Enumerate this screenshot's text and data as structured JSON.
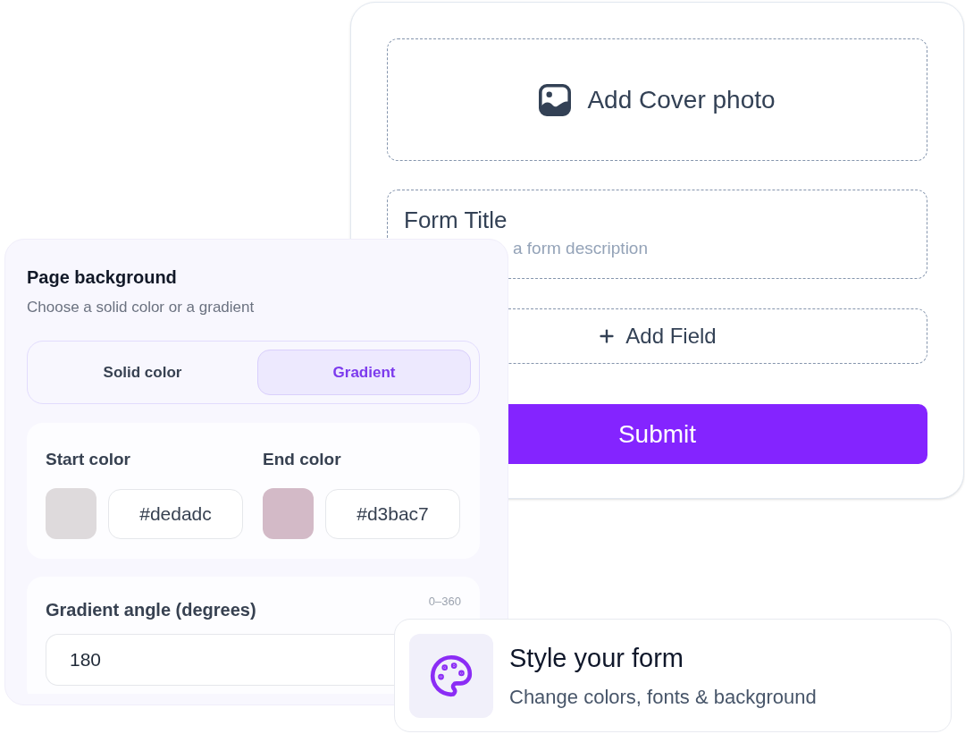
{
  "form_preview": {
    "cover_photo": {
      "label": "Add Cover photo"
    },
    "title": "Form Title",
    "description": "a form description",
    "add_field": {
      "label": "Add Field"
    },
    "submit": {
      "label": "Submit"
    }
  },
  "background_panel": {
    "title": "Page background",
    "subtitle": "Choose a solid color or a gradient",
    "modes": [
      {
        "label": "Solid color",
        "selected": false
      },
      {
        "label": "Gradient",
        "selected": true
      }
    ],
    "colors": [
      {
        "label": "Start color",
        "value": "#dedadc",
        "color": "#dedadc"
      },
      {
        "label": "End color",
        "value": "#d3bac7",
        "color": "#d3bac7"
      }
    ],
    "angle": {
      "label": "Gradient angle (degrees)",
      "range": "0–360",
      "value": "180"
    }
  },
  "promo": {
    "title": "Style your form",
    "subtitle": "Change colors, fonts & background"
  }
}
